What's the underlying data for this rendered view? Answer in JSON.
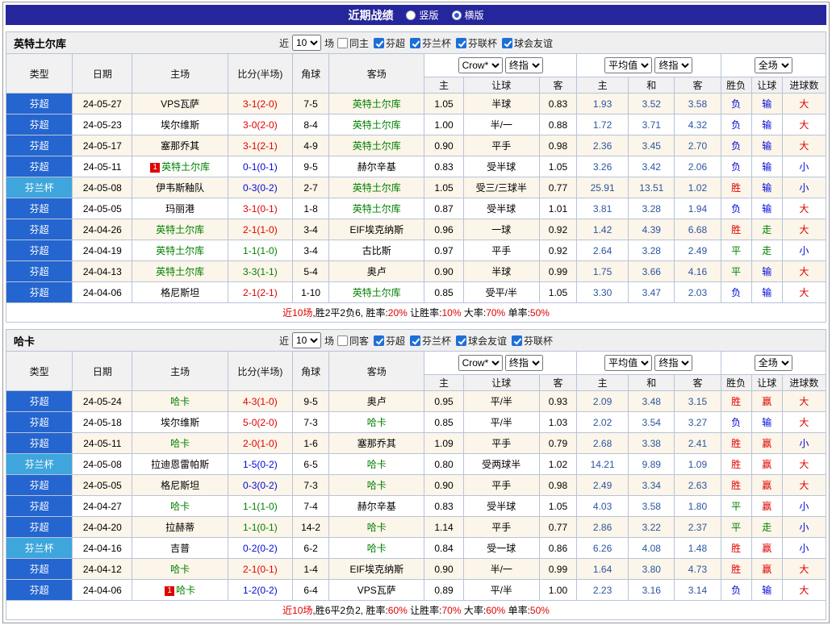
{
  "page": {
    "title": "近期战绩",
    "layout_options": [
      {
        "label": "竖版",
        "selected": false
      },
      {
        "label": "横版",
        "selected": true
      }
    ]
  },
  "table_header": {
    "type": "类型",
    "date": "日期",
    "home": "主场",
    "score": "比分(半场)",
    "corner": "角球",
    "away": "客场",
    "group1_select1": "Crow*",
    "group1_select2": "终指",
    "group2_select1": "平均值",
    "group2_select2": "终指",
    "group3_select1": "全场",
    "sub": [
      "主",
      "让球",
      "客",
      "主",
      "和",
      "客",
      "胜负",
      "让球",
      "进球数"
    ]
  },
  "sections": [
    {
      "team": "英特土尔库",
      "filter": {
        "prefix": "近",
        "matches_value": "10",
        "suffix": "场",
        "same_label": "同主",
        "same_checked": false,
        "leagues": [
          {
            "label": "芬超",
            "checked": true
          },
          {
            "label": "芬兰杯",
            "checked": true
          },
          {
            "label": "芬联杯",
            "checked": true
          },
          {
            "label": "球会友谊",
            "checked": true
          }
        ]
      },
      "rows": [
        {
          "league": "芬超",
          "date": "24-05-27",
          "home": "VPS瓦萨",
          "home_tracked": false,
          "badge": "",
          "score": "3-1(2-0)",
          "result": "h",
          "corner": "7-5",
          "away": "英特土尔库",
          "away_tracked": true,
          "odds1": [
            "1.05",
            "半球",
            "0.83"
          ],
          "odds2": [
            "1.93",
            "3.52",
            "3.58"
          ],
          "results": [
            {
              "t": "负",
              "c": "b"
            },
            {
              "t": "输",
              "c": "b"
            },
            {
              "t": "大",
              "c": "r"
            }
          ]
        },
        {
          "league": "芬超",
          "date": "24-05-23",
          "home": "埃尔维斯",
          "home_tracked": false,
          "badge": "",
          "score": "3-0(2-0)",
          "result": "h",
          "corner": "8-4",
          "away": "英特土尔库",
          "away_tracked": true,
          "odds1": [
            "1.00",
            "半/一",
            "0.88"
          ],
          "odds2": [
            "1.72",
            "3.71",
            "4.32"
          ],
          "results": [
            {
              "t": "负",
              "c": "b"
            },
            {
              "t": "输",
              "c": "b"
            },
            {
              "t": "大",
              "c": "r"
            }
          ]
        },
        {
          "league": "芬超",
          "date": "24-05-17",
          "home": "塞那乔其",
          "home_tracked": false,
          "badge": "",
          "score": "3-1(2-1)",
          "result": "h",
          "corner": "4-9",
          "away": "英特土尔库",
          "away_tracked": true,
          "odds1": [
            "0.90",
            "平手",
            "0.98"
          ],
          "odds2": [
            "2.36",
            "3.45",
            "2.70"
          ],
          "results": [
            {
              "t": "负",
              "c": "b"
            },
            {
              "t": "输",
              "c": "b"
            },
            {
              "t": "大",
              "c": "r"
            }
          ]
        },
        {
          "league": "芬超",
          "date": "24-05-11",
          "home": "英特土尔库",
          "home_tracked": true,
          "badge": "1",
          "score": "0-1(0-1)",
          "result": "a",
          "corner": "9-5",
          "away": "赫尔辛基",
          "away_tracked": false,
          "odds1": [
            "0.83",
            "受半球",
            "1.05"
          ],
          "odds2": [
            "3.26",
            "3.42",
            "2.06"
          ],
          "results": [
            {
              "t": "负",
              "c": "b"
            },
            {
              "t": "输",
              "c": "b"
            },
            {
              "t": "小",
              "c": "b"
            }
          ]
        },
        {
          "league": "芬兰杯",
          "date": "24-05-08",
          "home": "伊韦斯釉队",
          "home_tracked": false,
          "badge": "",
          "score": "0-3(0-2)",
          "result": "a",
          "corner": "2-7",
          "away": "英特土尔库",
          "away_tracked": true,
          "odds1": [
            "1.05",
            "受三/三球半",
            "0.77"
          ],
          "odds2": [
            "25.91",
            "13.51",
            "1.02"
          ],
          "results": [
            {
              "t": "胜",
              "c": "r"
            },
            {
              "t": "输",
              "c": "b"
            },
            {
              "t": "小",
              "c": "b"
            }
          ]
        },
        {
          "league": "芬超",
          "date": "24-05-05",
          "home": "玛丽港",
          "home_tracked": false,
          "badge": "",
          "score": "3-1(0-1)",
          "result": "h",
          "corner": "1-8",
          "away": "英特土尔库",
          "away_tracked": true,
          "odds1": [
            "0.87",
            "受半球",
            "1.01"
          ],
          "odds2": [
            "3.81",
            "3.28",
            "1.94"
          ],
          "results": [
            {
              "t": "负",
              "c": "b"
            },
            {
              "t": "输",
              "c": "b"
            },
            {
              "t": "大",
              "c": "r"
            }
          ]
        },
        {
          "league": "芬超",
          "date": "24-04-26",
          "home": "英特土尔库",
          "home_tracked": true,
          "badge": "",
          "score": "2-1(1-0)",
          "result": "h",
          "corner": "3-4",
          "away": "EIF埃克纳斯",
          "away_tracked": false,
          "odds1": [
            "0.96",
            "一球",
            "0.92"
          ],
          "odds2": [
            "1.42",
            "4.39",
            "6.68"
          ],
          "results": [
            {
              "t": "胜",
              "c": "r"
            },
            {
              "t": "走",
              "c": "g"
            },
            {
              "t": "大",
              "c": "r"
            }
          ]
        },
        {
          "league": "芬超",
          "date": "24-04-19",
          "home": "英特土尔库",
          "home_tracked": true,
          "badge": "",
          "score": "1-1(1-0)",
          "result": "d",
          "corner": "3-4",
          "away": "古比斯",
          "away_tracked": false,
          "odds1": [
            "0.97",
            "平手",
            "0.92"
          ],
          "odds2": [
            "2.64",
            "3.28",
            "2.49"
          ],
          "results": [
            {
              "t": "平",
              "c": "g"
            },
            {
              "t": "走",
              "c": "g"
            },
            {
              "t": "小",
              "c": "b"
            }
          ]
        },
        {
          "league": "芬超",
          "date": "24-04-13",
          "home": "英特土尔库",
          "home_tracked": true,
          "badge": "",
          "score": "3-3(1-1)",
          "result": "d",
          "corner": "5-4",
          "away": "奥卢",
          "away_tracked": false,
          "odds1": [
            "0.90",
            "半球",
            "0.99"
          ],
          "odds2": [
            "1.75",
            "3.66",
            "4.16"
          ],
          "results": [
            {
              "t": "平",
              "c": "g"
            },
            {
              "t": "输",
              "c": "b"
            },
            {
              "t": "大",
              "c": "r"
            }
          ]
        },
        {
          "league": "芬超",
          "date": "24-04-06",
          "home": "格尼斯坦",
          "home_tracked": false,
          "badge": "",
          "score": "2-1(2-1)",
          "result": "h",
          "corner": "1-10",
          "away": "英特土尔库",
          "away_tracked": true,
          "odds1": [
            "0.85",
            "受平/半",
            "1.05"
          ],
          "odds2": [
            "3.30",
            "3.47",
            "2.03"
          ],
          "results": [
            {
              "t": "负",
              "c": "b"
            },
            {
              "t": "输",
              "c": "b"
            },
            {
              "t": "大",
              "c": "r"
            }
          ]
        }
      ],
      "summary": {
        "prefix": "近10场",
        "record": ",胜2平2负6, ",
        "stats": [
          {
            "label": "胜率:",
            "value": "20%"
          },
          {
            "label": "让胜率:",
            "value": "10%"
          },
          {
            "label": "大率:",
            "value": "70%"
          },
          {
            "label": "单率:",
            "value": "50%"
          }
        ]
      }
    },
    {
      "team": "哈卡",
      "filter": {
        "prefix": "近",
        "matches_value": "10",
        "suffix": "场",
        "same_label": "同客",
        "same_checked": false,
        "leagues": [
          {
            "label": "芬超",
            "checked": true
          },
          {
            "label": "芬兰杯",
            "checked": true
          },
          {
            "label": "球会友谊",
            "checked": true
          },
          {
            "label": "芬联杯",
            "checked": true
          }
        ]
      },
      "rows": [
        {
          "league": "芬超",
          "date": "24-05-24",
          "home": "哈卡",
          "home_tracked": true,
          "badge": "",
          "score": "4-3(1-0)",
          "result": "h",
          "corner": "9-5",
          "away": "奥卢",
          "away_tracked": false,
          "odds1": [
            "0.95",
            "平/半",
            "0.93"
          ],
          "odds2": [
            "2.09",
            "3.48",
            "3.15"
          ],
          "results": [
            {
              "t": "胜",
              "c": "r"
            },
            {
              "t": "赢",
              "c": "r"
            },
            {
              "t": "大",
              "c": "r"
            }
          ]
        },
        {
          "league": "芬超",
          "date": "24-05-18",
          "home": "埃尔维斯",
          "home_tracked": false,
          "badge": "",
          "score": "5-0(2-0)",
          "result": "h",
          "corner": "7-3",
          "away": "哈卡",
          "away_tracked": true,
          "odds1": [
            "0.85",
            "平/半",
            "1.03"
          ],
          "odds2": [
            "2.02",
            "3.54",
            "3.27"
          ],
          "results": [
            {
              "t": "负",
              "c": "b"
            },
            {
              "t": "输",
              "c": "b"
            },
            {
              "t": "大",
              "c": "r"
            }
          ]
        },
        {
          "league": "芬超",
          "date": "24-05-11",
          "home": "哈卡",
          "home_tracked": true,
          "badge": "",
          "score": "2-0(1-0)",
          "result": "h",
          "corner": "1-6",
          "away": "塞那乔其",
          "away_tracked": false,
          "odds1": [
            "1.09",
            "平手",
            "0.79"
          ],
          "odds2": [
            "2.68",
            "3.38",
            "2.41"
          ],
          "results": [
            {
              "t": "胜",
              "c": "r"
            },
            {
              "t": "赢",
              "c": "r"
            },
            {
              "t": "小",
              "c": "b"
            }
          ]
        },
        {
          "league": "芬兰杯",
          "date": "24-05-08",
          "home": "拉迪恩雷帕斯",
          "home_tracked": false,
          "badge": "",
          "score": "1-5(0-2)",
          "result": "a",
          "corner": "6-5",
          "away": "哈卡",
          "away_tracked": true,
          "odds1": [
            "0.80",
            "受两球半",
            "1.02"
          ],
          "odds2": [
            "14.21",
            "9.89",
            "1.09"
          ],
          "results": [
            {
              "t": "胜",
              "c": "r"
            },
            {
              "t": "赢",
              "c": "r"
            },
            {
              "t": "大",
              "c": "r"
            }
          ]
        },
        {
          "league": "芬超",
          "date": "24-05-05",
          "home": "格尼斯坦",
          "home_tracked": false,
          "badge": "",
          "score": "0-3(0-2)",
          "result": "a",
          "corner": "7-3",
          "away": "哈卡",
          "away_tracked": true,
          "odds1": [
            "0.90",
            "平手",
            "0.98"
          ],
          "odds2": [
            "2.49",
            "3.34",
            "2.63"
          ],
          "results": [
            {
              "t": "胜",
              "c": "r"
            },
            {
              "t": "赢",
              "c": "r"
            },
            {
              "t": "大",
              "c": "r"
            }
          ]
        },
        {
          "league": "芬超",
          "date": "24-04-27",
          "home": "哈卡",
          "home_tracked": true,
          "badge": "",
          "score": "1-1(1-0)",
          "result": "d",
          "corner": "7-4",
          "away": "赫尔辛基",
          "away_tracked": false,
          "odds1": [
            "0.83",
            "受半球",
            "1.05"
          ],
          "odds2": [
            "4.03",
            "3.58",
            "1.80"
          ],
          "results": [
            {
              "t": "平",
              "c": "g"
            },
            {
              "t": "赢",
              "c": "r"
            },
            {
              "t": "小",
              "c": "b"
            }
          ]
        },
        {
          "league": "芬超",
          "date": "24-04-20",
          "home": "拉赫蒂",
          "home_tracked": false,
          "badge": "",
          "score": "1-1(0-1)",
          "result": "d",
          "corner": "14-2",
          "away": "哈卡",
          "away_tracked": true,
          "odds1": [
            "1.14",
            "平手",
            "0.77"
          ],
          "odds2": [
            "2.86",
            "3.22",
            "2.37"
          ],
          "results": [
            {
              "t": "平",
              "c": "g"
            },
            {
              "t": "走",
              "c": "g"
            },
            {
              "t": "小",
              "c": "b"
            }
          ]
        },
        {
          "league": "芬兰杯",
          "date": "24-04-16",
          "home": "吉普",
          "home_tracked": false,
          "badge": "",
          "score": "0-2(0-2)",
          "result": "a",
          "corner": "6-2",
          "away": "哈卡",
          "away_tracked": true,
          "odds1": [
            "0.84",
            "受一球",
            "0.86"
          ],
          "odds2": [
            "6.26",
            "4.08",
            "1.48"
          ],
          "results": [
            {
              "t": "胜",
              "c": "r"
            },
            {
              "t": "赢",
              "c": "r"
            },
            {
              "t": "小",
              "c": "b"
            }
          ]
        },
        {
          "league": "芬超",
          "date": "24-04-12",
          "home": "哈卡",
          "home_tracked": true,
          "badge": "",
          "score": "2-1(0-1)",
          "result": "h",
          "corner": "1-4",
          "away": "EIF埃克纳斯",
          "away_tracked": false,
          "odds1": [
            "0.90",
            "半/一",
            "0.99"
          ],
          "odds2": [
            "1.64",
            "3.80",
            "4.73"
          ],
          "results": [
            {
              "t": "胜",
              "c": "r"
            },
            {
              "t": "赢",
              "c": "r"
            },
            {
              "t": "大",
              "c": "r"
            }
          ]
        },
        {
          "league": "芬超",
          "date": "24-04-06",
          "home": "哈卡",
          "home_tracked": true,
          "badge": "1",
          "score": "1-2(0-2)",
          "result": "a",
          "corner": "6-4",
          "away": "VPS瓦萨",
          "away_tracked": false,
          "odds1": [
            "0.89",
            "平/半",
            "1.00"
          ],
          "odds2": [
            "2.23",
            "3.16",
            "3.14"
          ],
          "results": [
            {
              "t": "负",
              "c": "b"
            },
            {
              "t": "输",
              "c": "b"
            },
            {
              "t": "大",
              "c": "r"
            }
          ]
        }
      ],
      "summary": {
        "prefix": "近10场",
        "record": ",胜6平2负2, ",
        "stats": [
          {
            "label": "胜率:",
            "value": "60%"
          },
          {
            "label": "让胜率:",
            "value": "70%"
          },
          {
            "label": "大率:",
            "value": "60%"
          },
          {
            "label": "单率:",
            "value": "50%"
          }
        ]
      }
    }
  ]
}
